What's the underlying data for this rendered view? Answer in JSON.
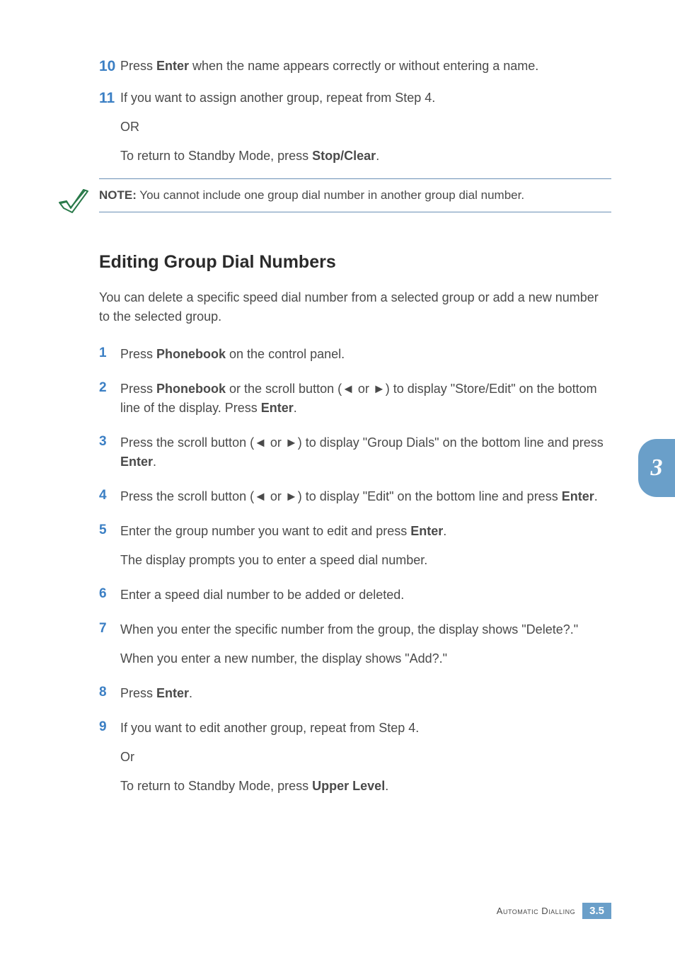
{
  "steps_top": [
    {
      "num": "10",
      "paragraphs": [
        {
          "segments": [
            {
              "t": "Press "
            },
            {
              "t": "Enter",
              "b": true
            },
            {
              "t": " when the name appears correctly or without entering a name."
            }
          ]
        }
      ]
    },
    {
      "num": "11",
      "paragraphs": [
        {
          "segments": [
            {
              "t": "If you want to assign another group, repeat from Step 4."
            }
          ]
        },
        {
          "segments": [
            {
              "t": "OR"
            }
          ]
        },
        {
          "segments": [
            {
              "t": "To return to Standby Mode, press "
            },
            {
              "t": "Stop/Clear",
              "b": true
            },
            {
              "t": "."
            }
          ]
        }
      ]
    }
  ],
  "note": {
    "label": "NOTE:",
    "text": " You cannot include one group dial number in another group dial number."
  },
  "heading": "Editing Group Dial Numbers",
  "intro": "You can delete a specific speed dial number from a selected group or add a new number to the selected group.",
  "steps_main": [
    {
      "num": "1",
      "paragraphs": [
        {
          "segments": [
            {
              "t": "Press "
            },
            {
              "t": "Phonebook",
              "b": true
            },
            {
              "t": " on the control panel."
            }
          ]
        }
      ]
    },
    {
      "num": "2",
      "paragraphs": [
        {
          "segments": [
            {
              "t": "Press "
            },
            {
              "t": "Phonebook",
              "b": true
            },
            {
              "t": " or the scroll button (◄ or ►) to display \"Store/Edit\" on the bottom line of the display. Press "
            },
            {
              "t": "Enter",
              "b": true
            },
            {
              "t": "."
            }
          ]
        }
      ]
    },
    {
      "num": "3",
      "paragraphs": [
        {
          "segments": [
            {
              "t": "Press the scroll button (◄ or ►) to display \"Group Dials\" on the bottom line and press "
            },
            {
              "t": "Enter",
              "b": true
            },
            {
              "t": "."
            }
          ]
        }
      ]
    },
    {
      "num": "4",
      "paragraphs": [
        {
          "segments": [
            {
              "t": "Press the scroll button (◄ or ►) to display \"Edit\" on the bottom line and press "
            },
            {
              "t": "Enter",
              "b": true
            },
            {
              "t": "."
            }
          ]
        }
      ]
    },
    {
      "num": "5",
      "paragraphs": [
        {
          "segments": [
            {
              "t": "Enter the group number you want to edit and press "
            },
            {
              "t": "Enter",
              "b": true
            },
            {
              "t": "."
            }
          ]
        },
        {
          "segments": [
            {
              "t": " The display prompts you to enter a speed dial number."
            }
          ]
        }
      ]
    },
    {
      "num": "6",
      "paragraphs": [
        {
          "segments": [
            {
              "t": "Enter a speed dial number to be added or deleted."
            }
          ]
        }
      ]
    },
    {
      "num": "7",
      "paragraphs": [
        {
          "segments": [
            {
              "t": "When you enter the specific number from the group, the display shows \"Delete?.\""
            }
          ]
        },
        {
          "segments": [
            {
              "t": "When you enter a new number, the display shows \"Add?.\""
            }
          ]
        }
      ]
    },
    {
      "num": "8",
      "paragraphs": [
        {
          "segments": [
            {
              "t": "Press "
            },
            {
              "t": "Enter",
              "b": true
            },
            {
              "t": "."
            }
          ]
        }
      ]
    },
    {
      "num": "9",
      "paragraphs": [
        {
          "segments": [
            {
              "t": " If you want to edit another group, repeat from Step 4."
            }
          ]
        },
        {
          "segments": [
            {
              "t": "Or"
            }
          ]
        },
        {
          "segments": [
            {
              "t": "To return to Standby Mode, press "
            },
            {
              "t": "Upper Level",
              "b": true
            },
            {
              "t": "."
            }
          ]
        }
      ]
    }
  ],
  "side_tab": "3",
  "footer": {
    "section": "Automatic Dialling",
    "page": "3.5"
  }
}
